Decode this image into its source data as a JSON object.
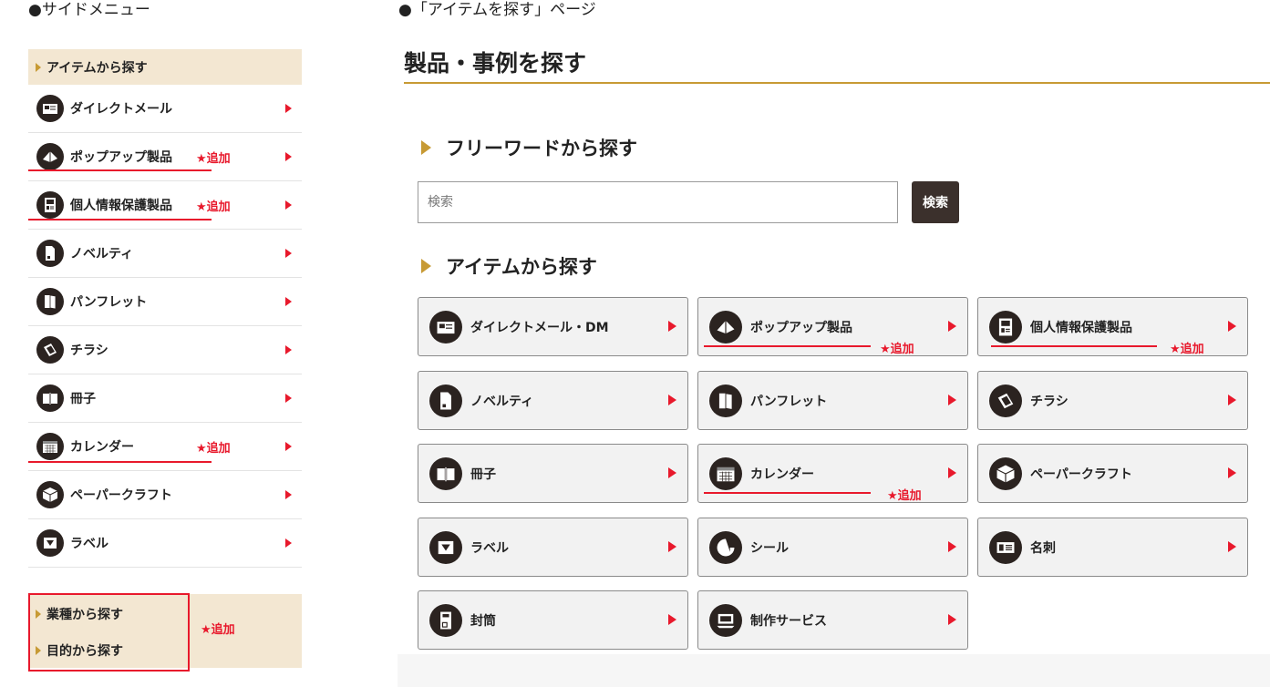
{
  "side_label": "●サイドメニュー",
  "page_label": "●「アイテムを探す」ページ",
  "side": {
    "heading": "アイテムから探す",
    "items": [
      {
        "label": "ダイレクトメール",
        "icon": "direct-mail-icon",
        "badge": ""
      },
      {
        "label": "ポップアップ製品",
        "icon": "popup-icon",
        "badge": "★追加"
      },
      {
        "label": "個人情報保護製品",
        "icon": "privacy-icon",
        "badge": "★追加"
      },
      {
        "label": "ノベルティ",
        "icon": "novelty-icon",
        "badge": ""
      },
      {
        "label": "パンフレット",
        "icon": "pamphlet-icon",
        "badge": ""
      },
      {
        "label": "チラシ",
        "icon": "flyer-icon",
        "badge": ""
      },
      {
        "label": "冊子",
        "icon": "booklet-icon",
        "badge": ""
      },
      {
        "label": "カレンダー",
        "icon": "calendar-icon",
        "badge": "★追加"
      },
      {
        "label": "ペーパークラフト",
        "icon": "papercraft-icon",
        "badge": ""
      },
      {
        "label": "ラベル",
        "icon": "label-icon",
        "badge": ""
      }
    ],
    "bottom": {
      "industry": "業種から探す",
      "purpose": "目的から探す",
      "badge": "★追加"
    }
  },
  "page": {
    "title": "製品・事例を探す",
    "freeword_heading": "フリーワードから探す",
    "search_placeholder": "検索",
    "search_button": "検索",
    "item_heading": "アイテムから探す",
    "cards": [
      {
        "label": "ダイレクトメール・DM",
        "icon": "direct-mail-icon",
        "badge": ""
      },
      {
        "label": "ポップアップ製品",
        "icon": "popup-icon",
        "badge": "★追加"
      },
      {
        "label": "個人情報保護製品",
        "icon": "privacy-icon",
        "badge": "★追加"
      },
      {
        "label": "ノベルティ",
        "icon": "novelty-icon",
        "badge": ""
      },
      {
        "label": "パンフレット",
        "icon": "pamphlet-icon",
        "badge": ""
      },
      {
        "label": "チラシ",
        "icon": "flyer-icon",
        "badge": ""
      },
      {
        "label": "冊子",
        "icon": "booklet-icon",
        "badge": ""
      },
      {
        "label": "カレンダー",
        "icon": "calendar-icon",
        "badge": "★追加"
      },
      {
        "label": "ペーパークラフト",
        "icon": "papercraft-icon",
        "badge": ""
      },
      {
        "label": "ラベル",
        "icon": "label-icon",
        "badge": ""
      },
      {
        "label": "シール",
        "icon": "sticker-icon",
        "badge": ""
      },
      {
        "label": "名刺",
        "icon": "business-card-icon",
        "badge": ""
      },
      {
        "label": "封筒",
        "icon": "envelope-icon",
        "badge": ""
      },
      {
        "label": "制作サービス",
        "icon": "production-service-icon",
        "badge": ""
      }
    ]
  },
  "colors": {
    "accent_gold": "#c79a34",
    "menu_bg": "#f3e7d2",
    "highlight_red": "#e8192c",
    "icon_dark": "#2b2320",
    "button_dark": "#3b302c"
  }
}
